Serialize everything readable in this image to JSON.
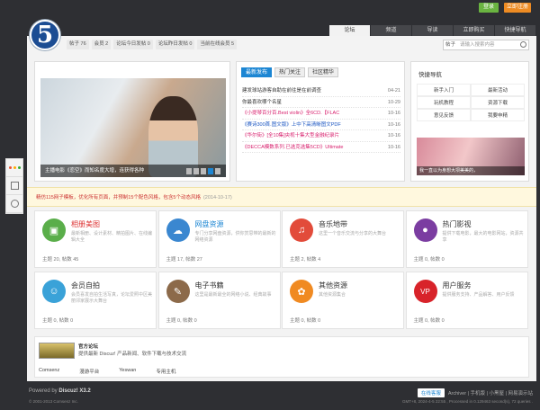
{
  "topbar": {
    "login": "登录",
    "register": "立即注册"
  },
  "logo": {
    "text": "5"
  },
  "nav": {
    "tabs": [
      "论坛",
      "频道",
      "导读",
      "立即购买",
      "快捷导航"
    ]
  },
  "stats": [
    "帖子 76",
    "会员 2",
    "论坛今日发帖 0",
    "论坛昨日发帖 0",
    "当前在线会员 5"
  ],
  "search": {
    "kind": "帖子",
    "placeholder": "请输入搜索内容"
  },
  "slider": {
    "caption": "主播电影《恋空》而知名度大增，连获得各种"
  },
  "news": {
    "tabs": [
      "最新发布",
      "热门关注",
      "社区精华"
    ],
    "items": [
      {
        "title": "建发球站游客自助在前往是在前调查",
        "date": "04-21",
        "color": "#333333"
      },
      {
        "title": "你最喜欢哪个名星",
        "date": "10-29",
        "color": "#333333"
      },
      {
        "title": "《小提琴百分百.Best violin》全6CD.【FLAC",
        "date": "10-16",
        "color": "#d81e6c"
      },
      {
        "title": "《赛诗300首.图文版》上中下高清晰图文PDF",
        "date": "10-16",
        "color": "#1a55c2"
      },
      {
        "title": "《华尔街》[全10集]央视十集大型金融纪录片",
        "date": "10-16",
        "color": "#d81e6c"
      },
      {
        "title": "《DECCA模数系列.已选克选集5CD》Ultimate",
        "date": "10-16",
        "color": "#d81e6c"
      }
    ]
  },
  "quick": {
    "title": "快捷导航",
    "items": [
      "新手入门",
      "最新活动",
      "玩机教程",
      "资源下载",
      "意见反馈",
      "我要申精"
    ],
    "caption": "我一直以为身想大坝美美的，"
  },
  "notice": {
    "text": "精仿115网子模板，优化所有页面，并预制15个配色风格，包含5个动态风格",
    "date": "(2014-10-17)"
  },
  "forums": [
    {
      "name": "相册美图",
      "desc": "最新相册、设计素材、精拍图片、在线编辑大全",
      "stat": "主题 20, 帖数 45",
      "color": "#5aae4a",
      "icon": "▣",
      "nameColor": "#d33"
    },
    {
      "name": "网盘资源",
      "desc": "专门分享网盘资源，供你赏思带的最新的网络资源",
      "stat": "主题 17, 帖数 27",
      "color": "#3a87d0",
      "icon": "☁",
      "nameColor": "#1c86d3"
    },
    {
      "name": "音乐地带",
      "desc": "这里一个音乐交流与分享的大舞台",
      "stat": "主题 2, 帖数 4",
      "color": "#e24b3a",
      "icon": "♫",
      "nameColor": "#333"
    },
    {
      "name": "热门影视",
      "desc": "提供下载电影，最大的电影网站，资源共享",
      "stat": "主题 0, 帖数 0",
      "color": "#7b3da1",
      "icon": "●",
      "nameColor": "#333"
    },
    {
      "name": "会员自拍",
      "desc": "会员喜发自拍生活写真，论坛爱照中区美丽邻家展示大舞台",
      "stat": "主题 0, 帖数 0",
      "color": "#3aa2d8",
      "icon": "☺",
      "nameColor": "#333"
    },
    {
      "name": "电子书籍",
      "desc": "这里是最新最全的网络小说、经典故事",
      "stat": "主题 0, 帖数 0",
      "color": "#8c6a4a",
      "icon": "✎",
      "nameColor": "#333"
    },
    {
      "name": "其他资源",
      "desc": "其他资源集合",
      "stat": "主题 0, 帖数 0",
      "color": "#f08a22",
      "icon": "✿",
      "nameColor": "#333"
    },
    {
      "name": "用户服务",
      "desc": "提供服务支持、产品解答、用户反馈",
      "stat": "主题 0, 帖数 0",
      "color": "#d8232a",
      "icon": "VP",
      "nameColor": "#333"
    }
  ],
  "friends": {
    "title": "官方论坛",
    "subtitle": "提供最新 Discuz! 产品新闻、软件下载与技术交流",
    "links": [
      "Comsenz",
      "漫游平台",
      "Yeswan",
      "专用主机"
    ]
  },
  "footer": {
    "powered": "Powered by",
    "brand": "Discuz! X3.2",
    "copyright": "© 2001-2013 Comsenz Inc.",
    "online": "在线客服",
    "links": "Archiver | 手机版 | 小黑屋 | 网易演示站",
    "meta": "GMT+8, 2024-4-5 22:55 , Processed in 0.129463 second(s), 72 queries ."
  }
}
